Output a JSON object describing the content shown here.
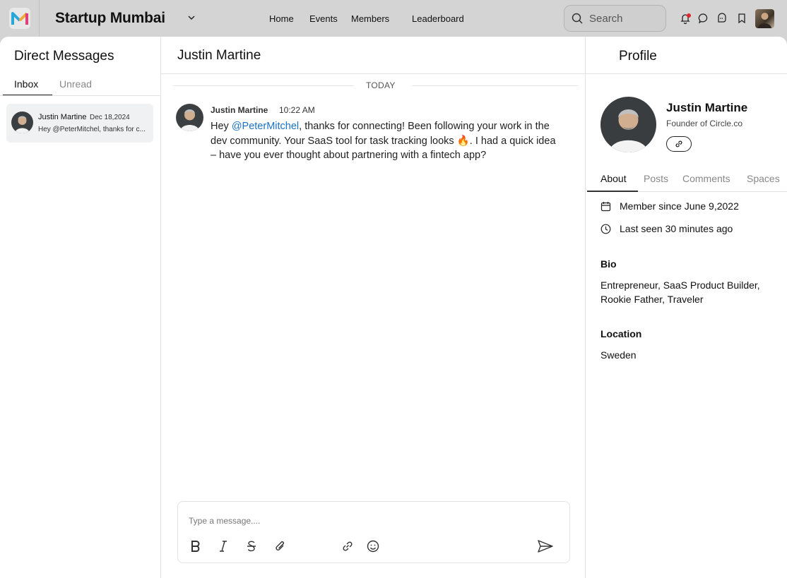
{
  "topbar": {
    "community_name": "Startup Mumbai",
    "nav": [
      "Home",
      "Events",
      "Members",
      "Leaderboard"
    ],
    "search_placeholder": "Search"
  },
  "inbox": {
    "title": "Direct Messages",
    "tabs": [
      "Inbox",
      "Unread"
    ],
    "active_tab": "Inbox",
    "conversations": [
      {
        "name": "Justin Martine",
        "date": "Dec 18,2024",
        "preview": "Hey @PeterMitchel, thanks for c..."
      }
    ]
  },
  "chat": {
    "title": "Justin Martine",
    "day_label": "TODAY",
    "messages": [
      {
        "author": "Justin Martine",
        "time": "10:22 AM",
        "text_before": "Hey ",
        "mention": "@PeterMitchel",
        "text_mid": ", thanks for connecting! Been following your work in the dev community. Your SaaS tool for task tracking looks ",
        "emoji": "🔥",
        "text_after": ". I had a quick idea – have you ever thought about partnering with a fintech app?"
      }
    ],
    "composer_placeholder": "Type a message...."
  },
  "profile": {
    "title": "Profile",
    "name": "Justin Martine",
    "role": "Founder of Circle.co",
    "tabs": [
      "About",
      "Posts",
      "Comments",
      "Spaces"
    ],
    "active_tab": "About",
    "member_since": "Member since June 9,2022",
    "last_seen": "Last seen 30 minutes ago",
    "bio_heading": "Bio",
    "bio": "Entrepreneur, SaaS Product Builder, Rookie Father, Traveler",
    "location_heading": "Location",
    "location": "Sweden"
  },
  "colors": {
    "mention": "#1b72c9",
    "notification_dot": "#e0262b",
    "selected_conversation_bg": "#eff1f2"
  }
}
